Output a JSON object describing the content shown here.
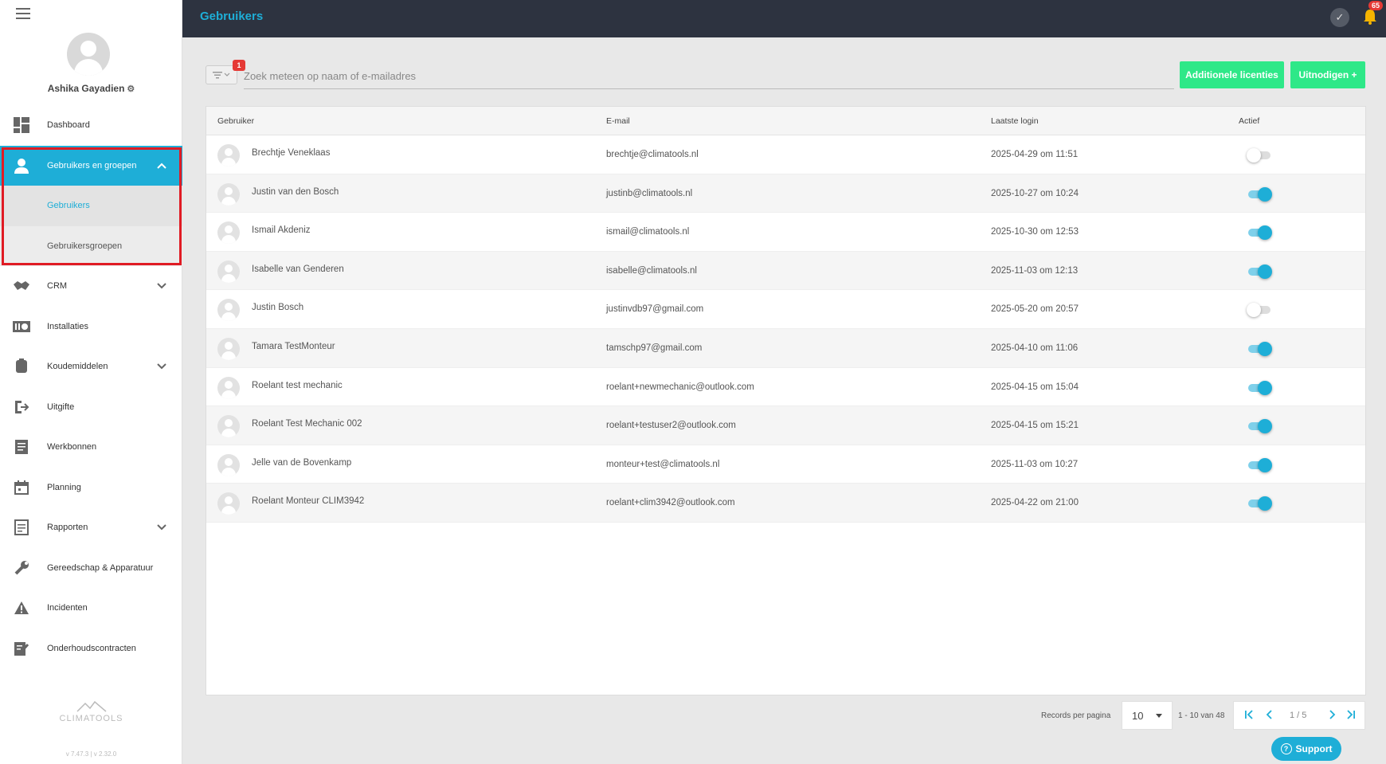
{
  "header": {
    "title": "Gebruikers",
    "notification_count": "65"
  },
  "user": {
    "name": "Ashika Gayadien"
  },
  "nav": {
    "dashboard": "Dashboard",
    "users_groups": "Gebruikers en groepen",
    "users": "Gebruikers",
    "user_groups": "Gebruikersgroepen",
    "crm": "CRM",
    "installaties": "Installaties",
    "koudemiddelen": "Koudemiddelen",
    "uitgifte": "Uitgifte",
    "werkbonnen": "Werkbonnen",
    "planning": "Planning",
    "rapporten": "Rapporten",
    "gereedschap": "Gereedschap & Apparatuur",
    "incidenten": "Incidenten",
    "onderhoudscontracten": "Onderhoudscontracten"
  },
  "brand": {
    "name": "CLIMATOOLS",
    "version": "v 7.47.3  | v 2.32.0"
  },
  "search": {
    "placeholder": "Zoek meteen op naam of e-mailadres",
    "filter_count": "1"
  },
  "actions": {
    "licenses": "Additionele licenties",
    "invite": "Uitnodigen +"
  },
  "table": {
    "columns": [
      "Gebruiker",
      "E-mail",
      "Laatste login",
      "Actief"
    ],
    "rows": [
      {
        "name": "Brechtje Veneklaas",
        "email": "brechtje@climatools.nl",
        "login": "2025-04-29 om 11:51",
        "active": false
      },
      {
        "name": "Justin van den Bosch",
        "email": "justinb@climatools.nl",
        "login": "2025-10-27 om 10:24",
        "active": true
      },
      {
        "name": "Ismail Akdeniz",
        "email": "ismail@climatools.nl",
        "login": "2025-10-30 om 12:53",
        "active": true
      },
      {
        "name": "Isabelle van Genderen",
        "email": "isabelle@climatools.nl",
        "login": "2025-11-03 om 12:13",
        "active": true
      },
      {
        "name": "Justin Bosch",
        "email": "justinvdb97@gmail.com",
        "login": "2025-05-20 om 20:57",
        "active": false
      },
      {
        "name": "Tamara TestMonteur",
        "email": "tamschp97@gmail.com",
        "login": "2025-04-10 om 11:06",
        "active": true
      },
      {
        "name": "Roelant test mechanic",
        "email": "roelant+newmechanic@outlook.com",
        "login": "2025-04-15 om 15:04",
        "active": true
      },
      {
        "name": "Roelant Test Mechanic 002",
        "email": "roelant+testuser2@outlook.com",
        "login": "2025-04-15 om 15:21",
        "active": true
      },
      {
        "name": "Jelle van de Bovenkamp",
        "email": "monteur+test@climatools.nl",
        "login": "2025-11-03 om 10:27",
        "active": true
      },
      {
        "name": "Roelant Monteur CLIM3942",
        "email": "roelant+clim3942@outlook.com",
        "login": "2025-04-22 om 21:00",
        "active": true
      }
    ]
  },
  "pagination": {
    "label": "Records per pagina",
    "per_page": "10",
    "range": "1 - 10 van 48",
    "page": "1 / 5"
  },
  "support": {
    "label": "Support"
  },
  "colors": {
    "accent": "#1eaed7",
    "green": "#2ee888",
    "topbar": "#2d3340",
    "highlight": "#e01b24"
  }
}
